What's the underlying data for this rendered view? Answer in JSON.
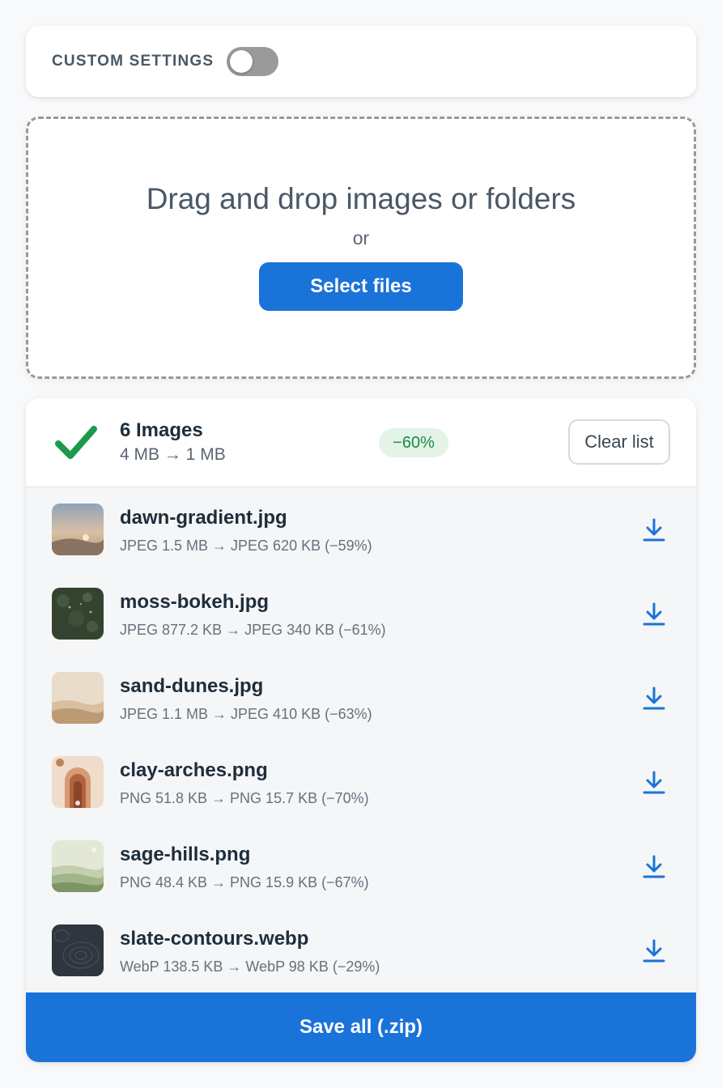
{
  "settings": {
    "label": "CUSTOM SETTINGS",
    "toggle_on": false
  },
  "dropzone": {
    "title": "Drag and drop images or folders",
    "or": "or",
    "select_label": "Select files"
  },
  "summary": {
    "count": "6 Images",
    "sizes": "4 MB → 1 MB",
    "badge": "−60%",
    "clear_label": "Clear list"
  },
  "files": [
    {
      "name": "dawn-gradient.jpg",
      "meta": "JPEG 1.5 MB → JPEG 620 KB (−59%)",
      "thumb": "dawn"
    },
    {
      "name": "moss-bokeh.jpg",
      "meta": "JPEG 877.2 KB → JPEG 340 KB (−61%)",
      "thumb": "moss"
    },
    {
      "name": "sand-dunes.jpg",
      "meta": "JPEG 1.1 MB → JPEG 410 KB (−63%)",
      "thumb": "sand"
    },
    {
      "name": "clay-arches.png",
      "meta": "PNG 51.8 KB → PNG 15.7 KB (−70%)",
      "thumb": "clay"
    },
    {
      "name": "sage-hills.png",
      "meta": "PNG 48.4 KB → PNG 15.9 KB (−67%)",
      "thumb": "sage"
    },
    {
      "name": "slate-contours.webp",
      "meta": "WebP 138.5 KB → WebP 98 KB (−29%)",
      "thumb": "slate"
    }
  ],
  "save_all_label": "Save all (.zip)",
  "colors": {
    "accent": "#1a73d9",
    "success": "#1b8a45",
    "toggle_off": "#9a9a9a"
  }
}
